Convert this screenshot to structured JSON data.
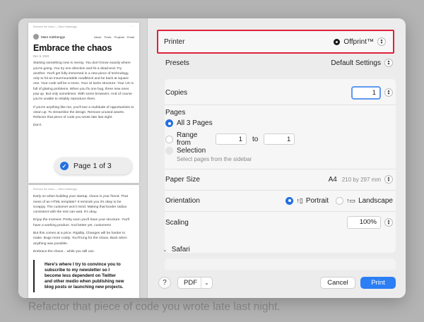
{
  "background_text": "Refactor that piece of code you wrote late last night.",
  "preview": {
    "page1": {
      "header_meta": "Embrace the chaos — Mare Kalsberggs",
      "author": "Mare Kalsberggs",
      "nav": [
        "About",
        "Posts",
        "Projects",
        "Email"
      ],
      "title": "Embrace the chaos",
      "date": "Dec 5, 2022",
      "paragraphs": [
        "Starting something new is messy. You don't know exactly where you're going. You try one direction and hit a dead-end. Try another. You'll get fully immersed in a new piece of technology, only to hit an insurmountable roadblock and be back at square one. Your code will be a mess. Your UI lacks structure. Your UX is full of glaring problems. When you fix one bug, three new ones pop up. But only sometimes. With some browsers. And of course you're unable to reliably reproduce them.",
        "If you're anything like me, you'll see a multitude of opportunities to clean up. To streamline the design. Remove unused assets. Refactor that piece of code you wrote late last night.",
        "Don't."
      ]
    },
    "page2": {
      "paragraphs": [
        "Early on when building your startup, chaos is your friend. That mess of an HTML template? It reminds you it's okay to be scrappy. The customer won't mind. Making that border radius consistent with the rest can wait. It's okay.",
        "Enjoy the moment. Pretty soon you'll have your structure. You'll have a working product. And better yet, customers!",
        "But this comes at a price. Rigidity. Changes will be harder to make. Bugs more costly. You'll long for the chaos. Back when anything was possible.",
        "Embrace the chaos... while you still can."
      ],
      "quote": "Here's where I try to convince you to subscribe to my newsletter so I become less dependent on Twitter and other medio when publishing new blog posts or launching new projects."
    },
    "page_badge": "Page 1 of 3"
  },
  "printer": {
    "label": "Printer",
    "value": "Offprint™"
  },
  "presets": {
    "label": "Presets",
    "value": "Default Settings"
  },
  "copies": {
    "label": "Copies",
    "value": "1"
  },
  "pages": {
    "label": "Pages",
    "all": "All 3 Pages",
    "range_label": "Range from",
    "range_from": "1",
    "range_to_label": "to",
    "range_to": "1",
    "selection": "Selection",
    "selection_hint": "Select pages from the sidebar"
  },
  "paper_size": {
    "label": "Paper Size",
    "value": "A4",
    "dims": "210 by 297 mm"
  },
  "orientation": {
    "label": "Orientation",
    "portrait": "Portrait",
    "landscape": "Landscape"
  },
  "scaling": {
    "label": "Scaling",
    "value": "100%"
  },
  "section_safari": "Safari",
  "buttons": {
    "help": "?",
    "pdf": "PDF",
    "cancel": "Cancel",
    "print": "Print"
  },
  "colors": {
    "accent": "#2b7ef4",
    "highlight_border": "#e0203a"
  }
}
